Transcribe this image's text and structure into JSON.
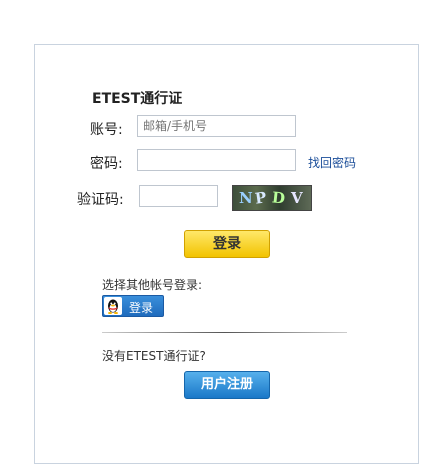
{
  "form": {
    "title": "ETEST通行证",
    "account_label": "账号:",
    "account_placeholder": "邮箱/手机号",
    "password_label": "密码:",
    "password_placeholder": "",
    "forgot_link": "找回密码",
    "captcha_label": "验证码:",
    "captcha_text": [
      "N",
      "P",
      "D",
      "V"
    ],
    "login_button": "登录"
  },
  "other_login": {
    "prompt": "选择其他帐号登录:",
    "qq_button": "登录",
    "qq_icon": "qq-penguin-icon"
  },
  "register": {
    "prompt": "没有ETEST通行证?",
    "button": "用户注册"
  },
  "colors": {
    "login_button": "#f2c300",
    "register_button": "#1a78c8",
    "link": "#1a4d99",
    "border": "#c9d3df"
  }
}
